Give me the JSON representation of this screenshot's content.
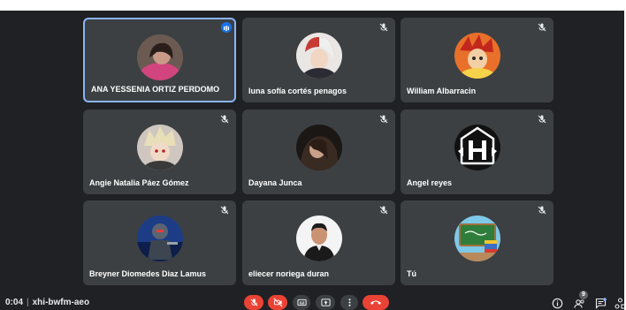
{
  "participants": [
    {
      "name": "ANA YESSENIA ORTIZ PERDOMO",
      "speaking": true,
      "avatar_icon": "girl-photo-avatar"
    },
    {
      "name": "luna sofía cortés penagos",
      "muted": true,
      "avatar_icon": "anime-character-avatar"
    },
    {
      "name": "William Albarracin",
      "muted": true,
      "avatar_icon": "anime-character-avatar"
    },
    {
      "name": "Angie Natalia Páez Gómez",
      "muted": true,
      "avatar_icon": "anime-character-avatar"
    },
    {
      "name": "Dayana Junca",
      "muted": true,
      "avatar_icon": "girl-photo-avatar"
    },
    {
      "name": "Angel reyes",
      "muted": true,
      "avatar_icon": "logo-avatar"
    },
    {
      "name": "Breyner Diomedes Diaz Lamus",
      "muted": true,
      "avatar_icon": "soldier-avatar"
    },
    {
      "name": "eliecer noriega duran",
      "muted": true,
      "avatar_icon": "man-photo-avatar"
    },
    {
      "name": "Tú",
      "muted": true,
      "avatar_icon": "classroom-avatar"
    }
  ],
  "meeting": {
    "time": "0:04",
    "separator": "|",
    "code": "xhi-bwfm-aeo"
  },
  "controls": {
    "mic": "mic-off-icon",
    "camera": "camera-off-icon",
    "captions": "captions-icon",
    "present": "present-icon",
    "more": "more-vert-icon",
    "leave": "call-end-icon"
  },
  "right_panel": {
    "participant_count": "9"
  },
  "colors": {
    "background": "#202124",
    "tile": "#3c4043",
    "accent": "#8ab4f8",
    "danger": "#ea4335"
  }
}
